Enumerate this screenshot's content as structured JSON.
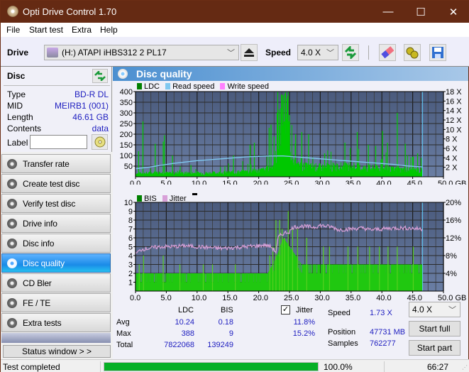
{
  "window": {
    "title": "Opti Drive Control 1.70",
    "minimize": "—",
    "maximize": "☐",
    "close": "✕"
  },
  "menu": [
    "File",
    "Start test",
    "Extra",
    "Help"
  ],
  "toolbar": {
    "drive_label": "Drive",
    "drive_value": "(H:)  ATAPI iHBS312  2 PL17",
    "speed_label": "Speed",
    "speed_value": "4.0 X",
    "icons": [
      "eject-icon",
      "refresh-icon",
      "erase-icon",
      "settings-icon",
      "save-icon"
    ]
  },
  "disc": {
    "heading": "Disc",
    "rows": [
      {
        "key": "Type",
        "value": "BD-R DL"
      },
      {
        "key": "MID",
        "value": "MEIRB1 (001)"
      },
      {
        "key": "Length",
        "value": "46.61 GB"
      },
      {
        "key": "Contents",
        "value": "data"
      }
    ],
    "label_key": "Label",
    "label_value": ""
  },
  "nav": {
    "items": [
      {
        "label": "Transfer rate",
        "active": false
      },
      {
        "label": "Create test disc",
        "active": false
      },
      {
        "label": "Verify test disc",
        "active": false
      },
      {
        "label": "Drive info",
        "active": false
      },
      {
        "label": "Disc info",
        "active": false
      },
      {
        "label": "Disc quality",
        "active": true
      },
      {
        "label": "CD Bler",
        "active": false
      },
      {
        "label": "FE / TE",
        "active": false
      },
      {
        "label": "Extra tests",
        "active": false
      }
    ],
    "status_window_button": "Status window > >"
  },
  "panel": {
    "title": "Disc quality"
  },
  "colors": {
    "ldc": "#00c800",
    "ldc_legend": "#008000",
    "read_speed": "#80c8f0",
    "write_speed": "#ff80ff",
    "bis": "#30d010",
    "jitter": "#d8a0d8",
    "plot_bg": "#56688a",
    "grid": "#333333",
    "accent_blue": "#2020c0",
    "progress": "#06b025"
  },
  "chart_data": [
    {
      "type": "bar",
      "title": "LDC / Read speed",
      "legend": [
        "LDC",
        "Read speed",
        "Write speed"
      ],
      "legend_position": "top-left",
      "x_ticks": [
        "0.0",
        "5.0",
        "10.0",
        "15.0",
        "20.0",
        "25.0",
        "30.0",
        "35.0",
        "40.0",
        "45.0",
        "50.0 GB"
      ],
      "xlim": [
        0,
        50
      ],
      "y_ticks": [
        "50",
        "100",
        "150",
        "200",
        "250",
        "300",
        "350",
        "400"
      ],
      "ylim": [
        0,
        400
      ],
      "y2_ticks": [
        "2 X",
        "4 X",
        "6 X",
        "8 X",
        "10 X",
        "12 X",
        "14 X",
        "16 X",
        "18 X"
      ],
      "y2lim": [
        0,
        18
      ],
      "grid": true,
      "end_marker_gb": 46.61,
      "ldc_baseline": [
        [
          0,
          15
        ],
        [
          2,
          18
        ],
        [
          4,
          20
        ],
        [
          6,
          17
        ],
        [
          8,
          18
        ],
        [
          10,
          19
        ],
        [
          12,
          18
        ],
        [
          14,
          20
        ],
        [
          16,
          22
        ],
        [
          18,
          25
        ],
        [
          20,
          30
        ],
        [
          21,
          35
        ],
        [
          22,
          40
        ],
        [
          23,
          110
        ],
        [
          23.5,
          260
        ],
        [
          24,
          300
        ],
        [
          24.5,
          310
        ],
        [
          25,
          230
        ],
        [
          25.5,
          60
        ],
        [
          27,
          50
        ],
        [
          30,
          45
        ],
        [
          33,
          50
        ],
        [
          36,
          45
        ],
        [
          39,
          40
        ],
        [
          42,
          35
        ],
        [
          44,
          35
        ],
        [
          46.6,
          30
        ]
      ],
      "ldc_spikes": [
        [
          0.5,
          120
        ],
        [
          1.2,
          260
        ],
        [
          3.2,
          155
        ],
        [
          4.5,
          165
        ],
        [
          4.7,
          195
        ],
        [
          6.0,
          100
        ],
        [
          9.0,
          55
        ],
        [
          15.9,
          100
        ],
        [
          18.6,
          150
        ],
        [
          19.3,
          160
        ],
        [
          21.7,
          230
        ],
        [
          22.0,
          245
        ],
        [
          22.5,
          190
        ],
        [
          23.0,
          300
        ],
        [
          23.3,
          315
        ],
        [
          23.7,
          385
        ],
        [
          24.0,
          360
        ],
        [
          24.3,
          330
        ],
        [
          24.7,
          380
        ],
        [
          25.0,
          290
        ],
        [
          26.0,
          200
        ],
        [
          27.0,
          210
        ],
        [
          28.1,
          200
        ],
        [
          30.7,
          110
        ],
        [
          32.8,
          60
        ],
        [
          34.0,
          160
        ],
        [
          36.0,
          210
        ],
        [
          37.8,
          150
        ],
        [
          39.0,
          145
        ],
        [
          40.1,
          215
        ],
        [
          40.9,
          160
        ],
        [
          42.5,
          300
        ],
        [
          43.8,
          155
        ],
        [
          45.0,
          95
        ],
        [
          45.8,
          110
        ]
      ],
      "read_speed_x": [
        [
          0,
          1.7
        ],
        [
          2,
          2.0
        ],
        [
          4,
          2.4
        ],
        [
          6,
          2.8
        ],
        [
          8,
          3.1
        ],
        [
          10,
          3.4
        ],
        [
          12,
          3.6
        ],
        [
          14,
          3.8
        ],
        [
          16,
          4.0
        ],
        [
          18,
          4.2
        ],
        [
          20,
          4.3
        ],
        [
          22,
          4.4
        ],
        [
          24,
          4.4
        ],
        [
          26,
          4.2
        ],
        [
          28,
          4.0
        ],
        [
          30,
          3.8
        ],
        [
          32,
          3.6
        ],
        [
          34,
          3.4
        ],
        [
          36,
          3.2
        ],
        [
          38,
          3.0
        ],
        [
          40,
          2.8
        ],
        [
          42,
          2.6
        ],
        [
          44,
          2.3
        ],
        [
          46.6,
          2.1
        ]
      ]
    },
    {
      "type": "bar",
      "title": "BIS / Jitter",
      "legend": [
        "BIS",
        "Jitter"
      ],
      "legend_position": "top-left",
      "x_ticks": [
        "0.0",
        "5.0",
        "10.0",
        "15.0",
        "20.0",
        "25.0",
        "30.0",
        "35.0",
        "40.0",
        "45.0",
        "50.0 GB"
      ],
      "xlim": [
        0,
        50
      ],
      "y_ticks": [
        "1",
        "2",
        "3",
        "4",
        "5",
        "6",
        "7",
        "8",
        "9",
        "10"
      ],
      "ylim": [
        0,
        10
      ],
      "y2_ticks": [
        "4%",
        "8%",
        "12%",
        "16%",
        "20%"
      ],
      "y2lim": [
        0,
        20
      ],
      "grid": true,
      "end_marker_gb": 46.61,
      "bis_baseline": [
        [
          0,
          2
        ],
        [
          5,
          2
        ],
        [
          10,
          2
        ],
        [
          15,
          2
        ],
        [
          20,
          2
        ],
        [
          21.5,
          2
        ],
        [
          23,
          4
        ],
        [
          24,
          6
        ],
        [
          25,
          5
        ],
        [
          26,
          4
        ],
        [
          27,
          3
        ],
        [
          30,
          3
        ],
        [
          35,
          3
        ],
        [
          40,
          3
        ],
        [
          44,
          3
        ],
        [
          46.6,
          3
        ]
      ],
      "bis_spikes": [
        [
          0.6,
          3
        ],
        [
          1.3,
          4
        ],
        [
          4.5,
          4
        ],
        [
          7.2,
          3
        ],
        [
          11.0,
          3
        ],
        [
          12.5,
          3
        ],
        [
          16.2,
          3
        ],
        [
          21.8,
          4
        ],
        [
          22.3,
          5
        ],
        [
          22.8,
          8
        ],
        [
          23.4,
          8
        ],
        [
          23.8,
          7
        ],
        [
          24.2,
          6
        ],
        [
          24.8,
          9
        ],
        [
          25.5,
          7
        ],
        [
          26.3,
          7
        ],
        [
          27.8,
          6
        ],
        [
          30.5,
          5
        ],
        [
          31.5,
          5
        ],
        [
          34.5,
          5
        ],
        [
          36.1,
          5
        ],
        [
          38.0,
          5
        ],
        [
          39.6,
          5
        ],
        [
          41.0,
          5
        ],
        [
          42.5,
          5
        ],
        [
          45.1,
          5
        ]
      ],
      "jitter_pct": [
        [
          0,
          8.4
        ],
        [
          1,
          9.4
        ],
        [
          2,
          9.6
        ],
        [
          4,
          10.0
        ],
        [
          6,
          10.0
        ],
        [
          8,
          10.2
        ],
        [
          10,
          10.0
        ],
        [
          12,
          9.8
        ],
        [
          14,
          9.6
        ],
        [
          16,
          9.8
        ],
        [
          18,
          10.0
        ],
        [
          20,
          10.2
        ],
        [
          21,
          10.4
        ],
        [
          22,
          10.0
        ],
        [
          22.8,
          8.8
        ],
        [
          23.2,
          12.2
        ],
        [
          24,
          13.0
        ],
        [
          25,
          13.4
        ],
        [
          25.6,
          14.4
        ],
        [
          27,
          14.6
        ],
        [
          29,
          14.4
        ],
        [
          30,
          14.8
        ],
        [
          32,
          14.4
        ],
        [
          33,
          13.8
        ],
        [
          35,
          14.0
        ],
        [
          37,
          14.2
        ],
        [
          38,
          13.8
        ],
        [
          40,
          14.0
        ],
        [
          42,
          14.2
        ],
        [
          44,
          14.2
        ],
        [
          46.6,
          14.0
        ]
      ]
    }
  ],
  "stats": {
    "col_ldc": "LDC",
    "col_bis": "BIS",
    "jitter_label": "Jitter",
    "jitter_checked": true,
    "rows": [
      {
        "label": "Avg",
        "ldc": "10.24",
        "bis": "0.18",
        "jitter": "11.8%"
      },
      {
        "label": "Max",
        "ldc": "388",
        "bis": "9",
        "jitter": "15.2%"
      },
      {
        "label": "Total",
        "ldc": "7822068",
        "bis": "139249",
        "jitter": ""
      }
    ],
    "speed_label": "Speed",
    "speed_value": "1.73 X",
    "position_label": "Position",
    "position_value": "47731 MB",
    "samples_label": "Samples",
    "samples_value": "762277",
    "speed_select": "4.0 X",
    "start_full": "Start full",
    "start_part": "Start part"
  },
  "statusbar": {
    "status": "Test completed",
    "progress_percent": 100,
    "progress_text": "100.0%",
    "elapsed": "66:27"
  }
}
